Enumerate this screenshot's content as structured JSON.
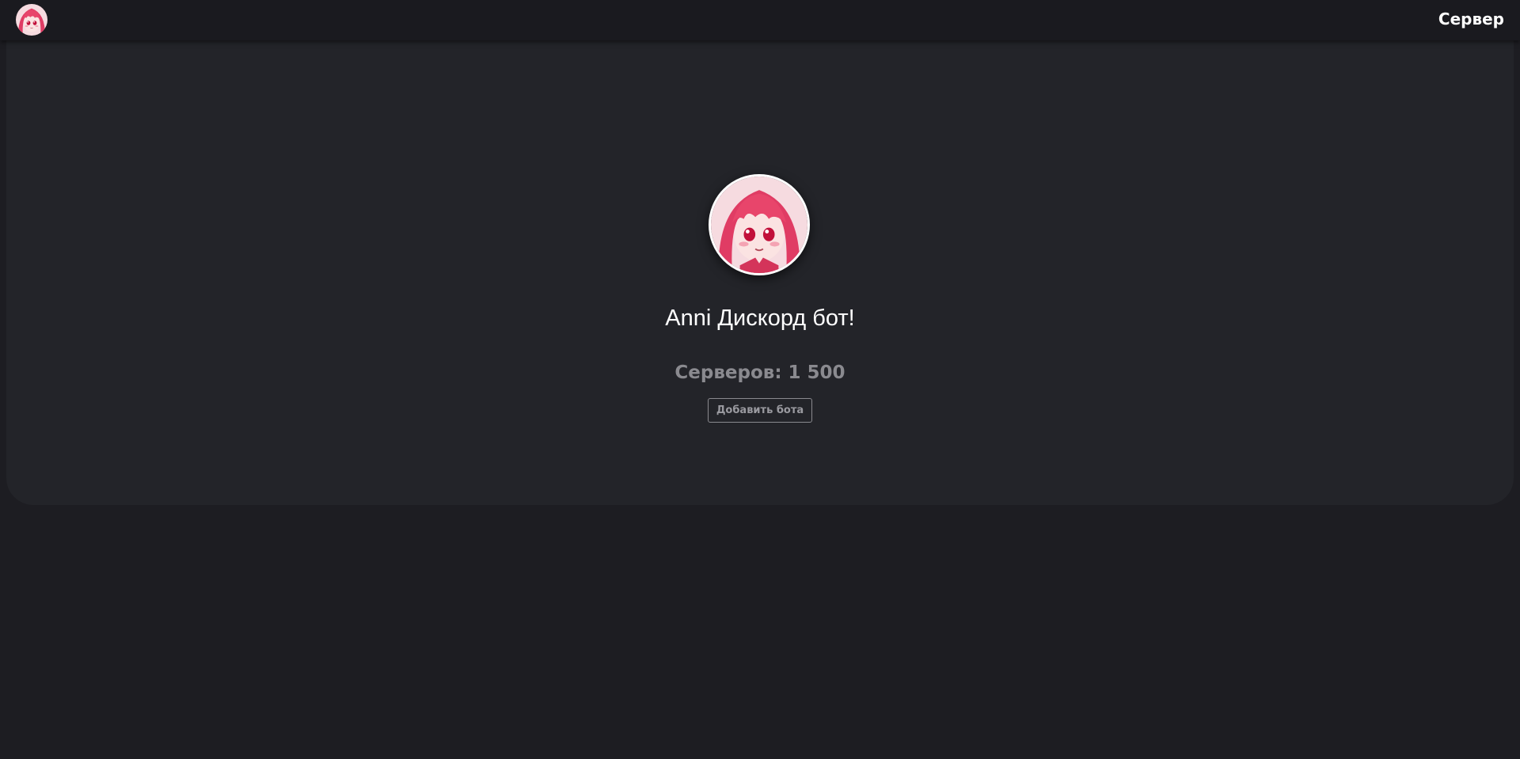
{
  "navbar": {
    "logo_icon": "bot-avatar-icon",
    "server_link_label": "Сервер"
  },
  "hero": {
    "avatar_icon": "bot-avatar-icon",
    "title": "Anni Дискорд бот!",
    "stats": "Серверов: 1 500",
    "add_bot_button_label": "Добавить бота"
  },
  "colors": {
    "page_background": "#1d1d22",
    "navbar_background": "#1a1a1f",
    "card_background": "#232429",
    "accent_pink": "#e8456b",
    "muted_text": "#8a8a8f"
  }
}
